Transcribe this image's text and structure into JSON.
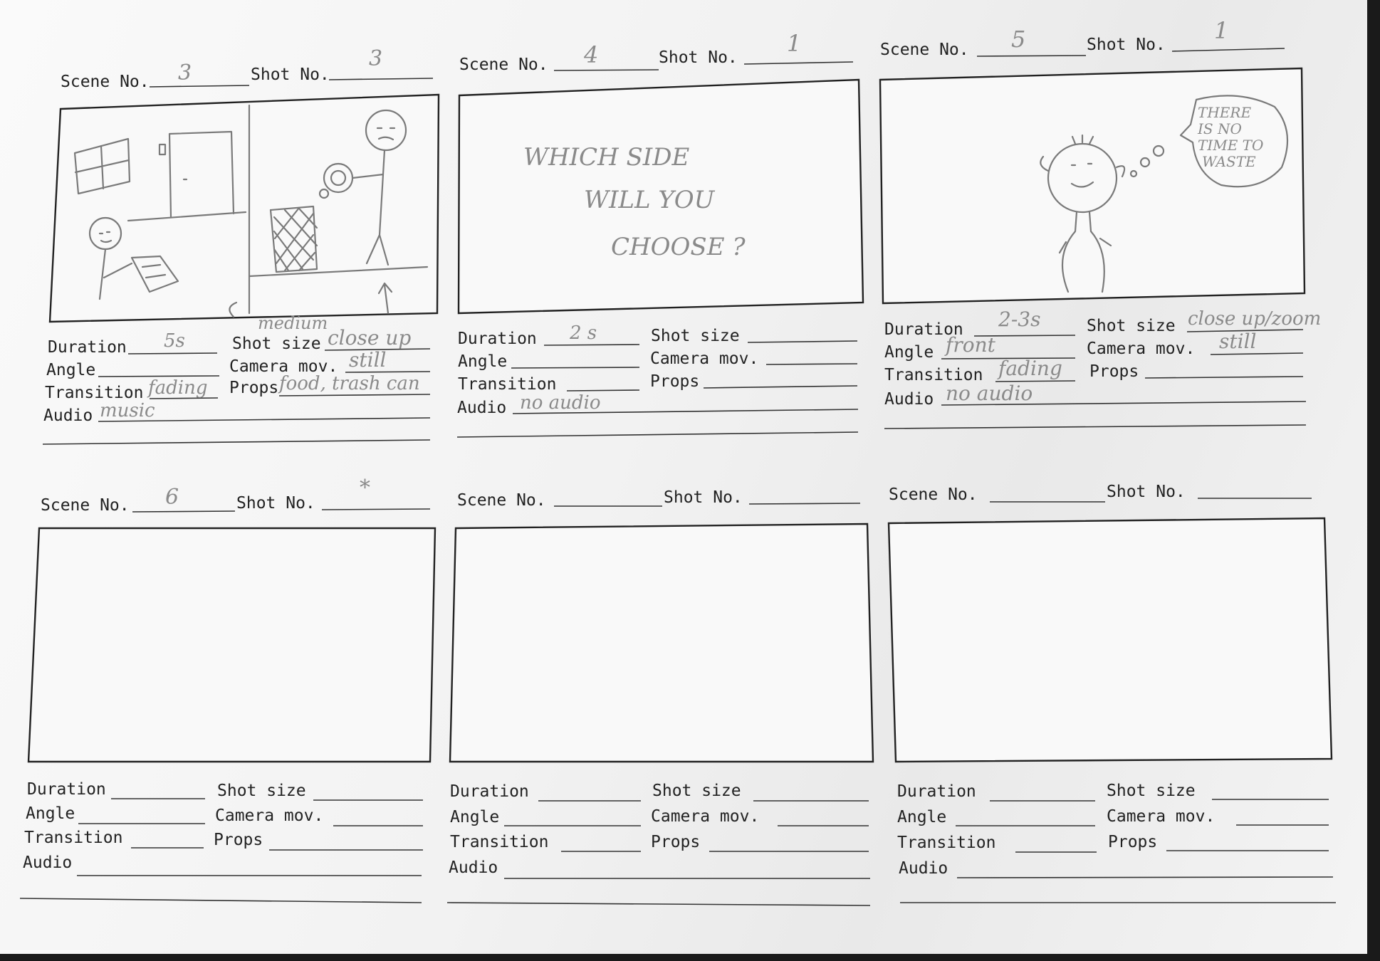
{
  "labels": {
    "scene_no": "Scene No.",
    "shot_no": "Shot No.",
    "duration": "Duration",
    "shot_size": "Shot size",
    "angle": "Angle",
    "camera_mov": "Camera mov.",
    "transition": "Transition",
    "props": "Props",
    "audio": "Audio"
  },
  "panels": [
    {
      "scene": "3",
      "shot": "3",
      "duration": "5s",
      "shot_size": "close up",
      "shot_size_note": "medium",
      "angle": "",
      "camera_mov": "still",
      "transition": "fading",
      "props": "food, trash can",
      "audio": "music"
    },
    {
      "scene": "4",
      "shot": "1",
      "duration": "2 s",
      "shot_size": "",
      "angle": "",
      "camera_mov": "",
      "transition": "",
      "props": "",
      "audio": "no audio",
      "frame_text": [
        "WHICH  SIDE",
        "WILL YOU",
        "CHOOSE ?"
      ]
    },
    {
      "scene": "5",
      "shot": "1",
      "duration": "2-3s",
      "shot_size": "close up/zoom",
      "angle": "front",
      "camera_mov": "still",
      "transition": "fading",
      "props": "",
      "audio": "no audio",
      "thought": [
        "THERE",
        "IS NO",
        "TIME TO",
        "WASTE"
      ]
    },
    {
      "scene": "6",
      "shot": "*",
      "duration": "",
      "shot_size": "",
      "angle": "",
      "camera_mov": "",
      "transition": "",
      "props": "",
      "audio": ""
    },
    {
      "scene": "",
      "shot": "",
      "duration": "",
      "shot_size": "",
      "angle": "",
      "camera_mov": "",
      "transition": "",
      "props": "",
      "audio": ""
    },
    {
      "scene": "",
      "shot": "",
      "duration": "",
      "shot_size": "",
      "angle": "",
      "camera_mov": "",
      "transition": "",
      "props": "",
      "audio": ""
    }
  ]
}
